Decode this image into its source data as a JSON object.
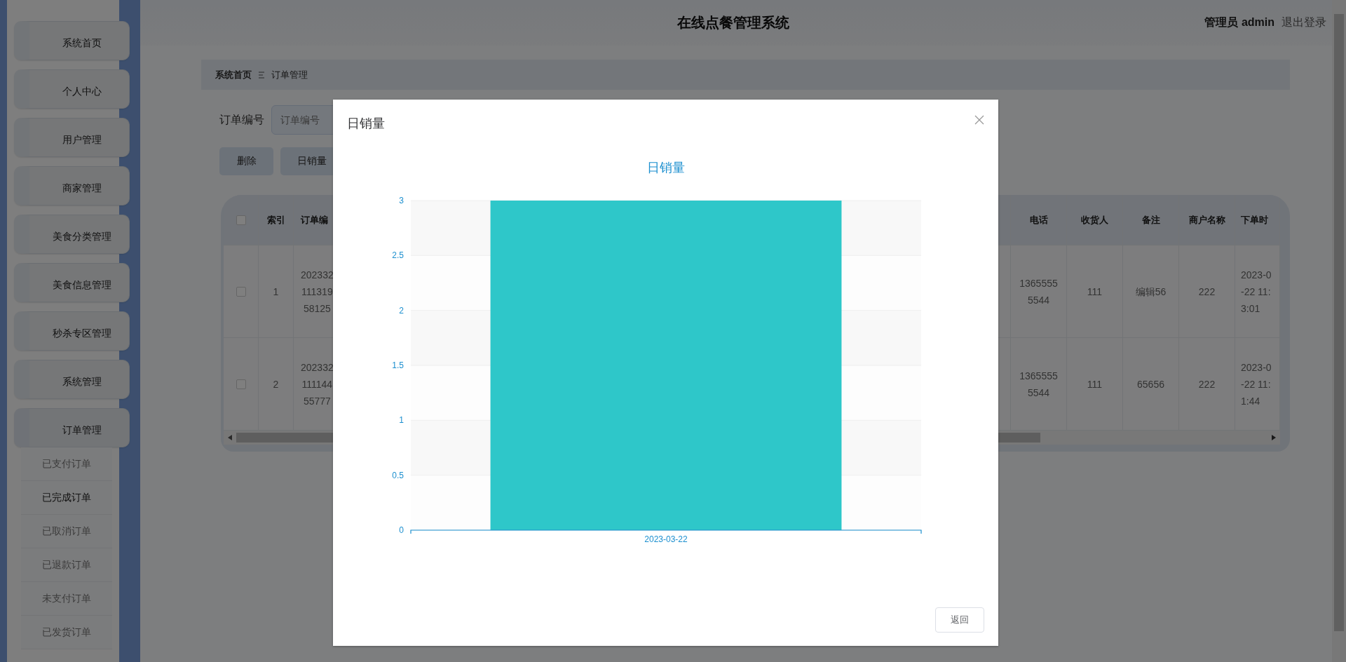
{
  "sidebar": {
    "items": [
      {
        "label": "系统首页",
        "expanded": false
      },
      {
        "label": "个人中心",
        "expanded": false
      },
      {
        "label": "用户管理",
        "expanded": false
      },
      {
        "label": "商家管理",
        "expanded": false
      },
      {
        "label": "美食分类管理",
        "expanded": false
      },
      {
        "label": "美食信息管理",
        "expanded": false
      },
      {
        "label": "秒杀专区管理",
        "expanded": false
      },
      {
        "label": "系统管理",
        "expanded": false
      },
      {
        "label": "订单管理",
        "expanded": true,
        "children": [
          {
            "label": "已支付订单",
            "selected": false
          },
          {
            "label": "已完成订单",
            "selected": true
          },
          {
            "label": "已取消订单",
            "selected": false
          },
          {
            "label": "已退款订单",
            "selected": false
          },
          {
            "label": "未支付订单",
            "selected": false
          },
          {
            "label": "已发货订单",
            "selected": false
          }
        ]
      }
    ]
  },
  "header": {
    "title": "在线点餐管理系统",
    "user_label": "管理员 admin",
    "logout": "退出登录"
  },
  "breadcrumb": [
    "系统首页",
    "订单管理"
  ],
  "search": {
    "label": "订单编号",
    "placeholder": "订单编号"
  },
  "buttons": [
    "删除",
    "日销量"
  ],
  "table": {
    "all_checked": false,
    "left_columns": [
      "索引",
      "订单编"
    ],
    "right_columns": [
      "电话",
      "收货人",
      "备注",
      "商户名称",
      "下单时"
    ],
    "rows": [
      {
        "checked": false,
        "left_cells": [
          "1",
          "202332\n111319\n58125"
        ],
        "right_cells": [
          "1365555\n5544",
          "111",
          "编辑56",
          "222",
          "2023-0\n-22 11:\n3:01"
        ]
      },
      {
        "checked": false,
        "left_cells": [
          "2",
          "202332\n111144\n55777"
        ],
        "right_cells": [
          "1365555\n5544",
          "111",
          "65656",
          "222",
          "2023-0\n-22 11:\n1:44"
        ]
      }
    ]
  },
  "modal": {
    "title": "日销量",
    "button": "返回",
    "chart_data": {
      "type": "bar",
      "title": "日销量",
      "categories": [
        "2023-03-22"
      ],
      "series": [
        {
          "color": "#2ec7c9",
          "values": [
            3
          ]
        }
      ],
      "grid": true,
      "ylim": [
        0,
        3
      ],
      "yticks": [
        0,
        0.5,
        1,
        1.5,
        2,
        2.5,
        3
      ]
    }
  }
}
